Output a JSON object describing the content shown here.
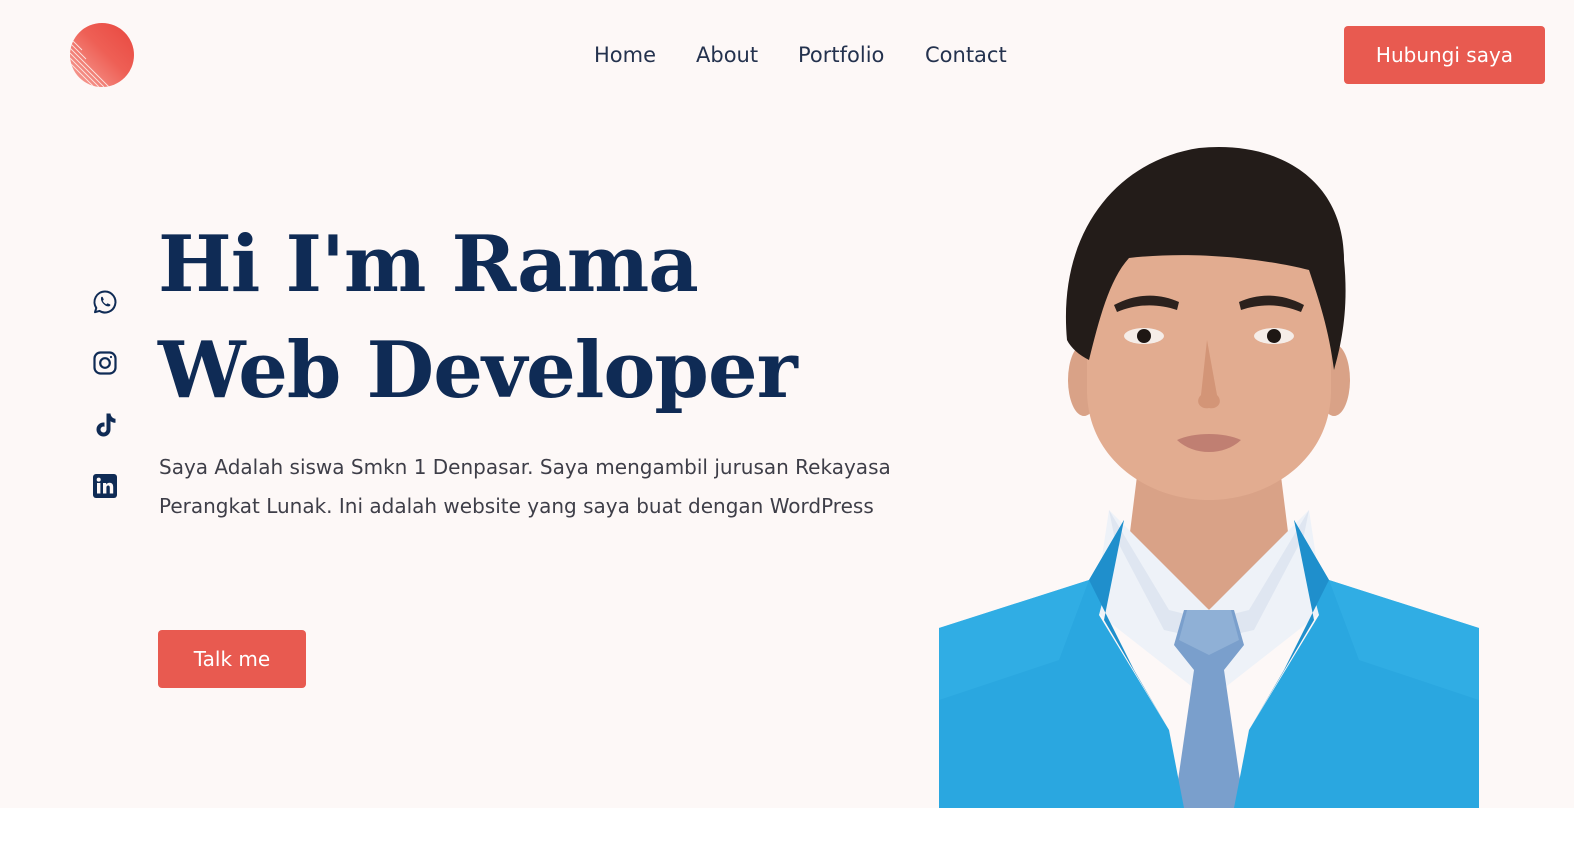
{
  "nav": {
    "items": [
      "Home",
      "About",
      "Portfolio",
      "Contact"
    ],
    "cta_label": "Hubungi saya"
  },
  "hero": {
    "headline_line1": "Hi I'm Rama",
    "headline_line2": "Web Developer",
    "description": "Saya Adalah siswa Smkn 1 Denpasar. Saya mengambil jurusan Rekayasa Perangkat Lunak. Ini adalah website yang saya buat dengan WordPress",
    "button_label": "Talk me"
  },
  "social_icons": [
    "whatsapp-icon",
    "instagram-icon",
    "tiktok-icon",
    "linkedin-icon"
  ],
  "colors": {
    "accent": "#e85a50",
    "heading": "#0f2b55",
    "background": "#fdf8f7",
    "jacket": "#2aa7e0"
  }
}
